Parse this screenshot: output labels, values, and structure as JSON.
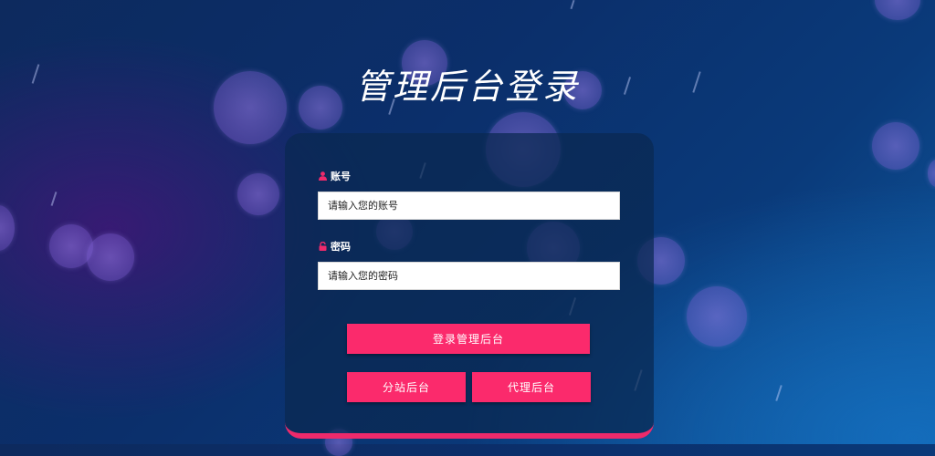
{
  "page": {
    "title": "管理后台登录"
  },
  "form": {
    "account": {
      "label": "账号",
      "placeholder": "请输入您的账号",
      "value": ""
    },
    "password": {
      "label": "密码",
      "placeholder": "请输入您的密码",
      "value": ""
    }
  },
  "buttons": {
    "login_admin": "登录管理后台",
    "branch_admin": "分站后台",
    "agent_admin": "代理后台"
  },
  "colors": {
    "accent": "#fb2a6c",
    "panel_border": "#ee2a6b",
    "icon": "#ee2a6b"
  }
}
